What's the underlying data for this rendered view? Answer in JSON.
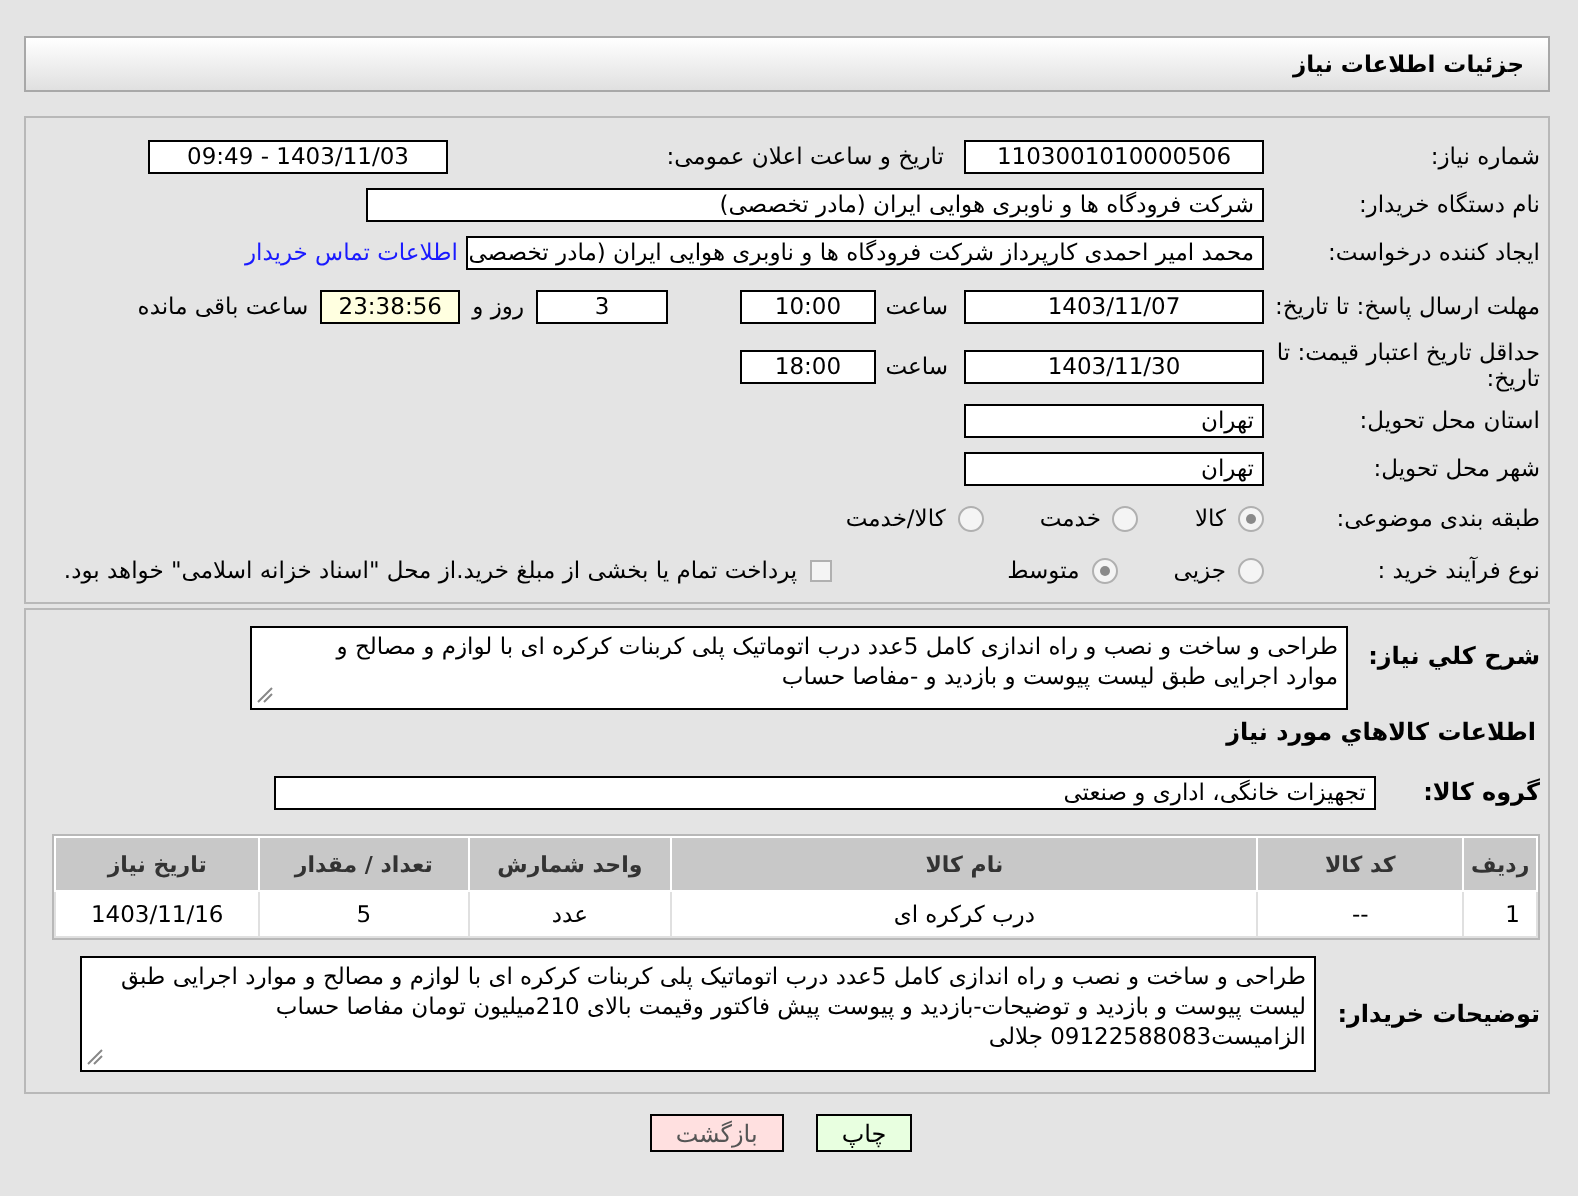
{
  "title": "جزئیات اطلاعات نیاز",
  "need_number": {
    "label": "شماره نیاز:",
    "value": "1103001010000506"
  },
  "announce_datetime": {
    "label": "تاریخ و ساعت اعلان عمومی:",
    "value": "1403/11/03 - 09:49"
  },
  "buyer_org": {
    "label": "نام دستگاه خریدار:",
    "value": "شرکت فرودگاه ها و ناوبری هوایی ایران (مادر تخصصی)"
  },
  "requester": {
    "label": "ایجاد کننده درخواست:",
    "value": "محمد امیر احمدی کارپرداز شرکت فرودگاه ها و ناوبری هوایی ایران (مادر تخصصی",
    "link": "اطلاعات تماس خریدار"
  },
  "reply_deadline": {
    "label": "مهلت ارسال پاسخ: تا تاریخ:",
    "date": "1403/11/07",
    "time_label": "ساعت",
    "time": "10:00",
    "days": "3",
    "days_label": "روز و",
    "remaining": "23:38:56",
    "remaining_label": "ساعت باقی مانده"
  },
  "price_validity": {
    "label": "حداقل تاریخ اعتبار قیمت: تا تاریخ:",
    "date": "1403/11/30",
    "time_label": "ساعت",
    "time": "18:00"
  },
  "province": {
    "label": "استان محل تحویل:",
    "value": "تهران"
  },
  "city": {
    "label": "شهر محل تحویل:",
    "value": "تهران"
  },
  "category": {
    "label": "طبقه بندی موضوعی:",
    "options": [
      {
        "label": "کالا",
        "selected": true
      },
      {
        "label": "خدمت",
        "selected": false
      },
      {
        "label": "کالا/خدمت",
        "selected": false
      }
    ]
  },
  "purchase_type": {
    "label": "نوع فرآیند خرید :",
    "options": [
      {
        "label": "جزیی",
        "selected": false
      },
      {
        "label": "متوسط",
        "selected": true
      }
    ],
    "treasury": {
      "label": "پرداخت تمام یا بخشی از مبلغ خرید.از محل \"اسناد خزانه اسلامی\" خواهد بود.",
      "checked": false
    }
  },
  "description": {
    "label": "شرح کلي نیاز:",
    "value": "طراحی و ساخت و نصب و راه اندازی کامل 5عدد درب اتوماتیک پلی کربنات کرکره ای با لوازم و مصالح و موارد اجرایی طبق لیست پیوست و بازدید و -مفاصا حساب"
  },
  "goods_section": "اطلاعات کالاهاي مورد نیاز",
  "goods_group": {
    "label": "گروه کالا:",
    "value": "تجهیزات خانگی، اداری و صنعتی"
  },
  "table": {
    "columns": [
      "ردیف",
      "کد کالا",
      "نام کالا",
      "واحد شمارش",
      "تعداد / مقدار",
      "تاریخ نیاز"
    ],
    "rows": [
      [
        "1",
        "--",
        "درب کرکره ای",
        "عدد",
        "5",
        "1403/11/16"
      ]
    ]
  },
  "buyer_notes": {
    "label": "توضیحات خریدار:",
    "value": "طراحی و ساخت و نصب و راه اندازی کامل 5عدد درب اتوماتیک پلی کربنات کرکره ای با لوازم و مصالح و موارد اجرایی طبق لیست پیوست و بازدید و توضیحات-بازدید و پیوست پیش فاکتور وقیمت بالای 210میلیون تومان مفاصا حساب الزامیست09122588083 جلالی"
  },
  "buttons": [
    {
      "label": "چاپ",
      "kind": "print"
    },
    {
      "label": "بازگشت",
      "kind": "back"
    }
  ]
}
